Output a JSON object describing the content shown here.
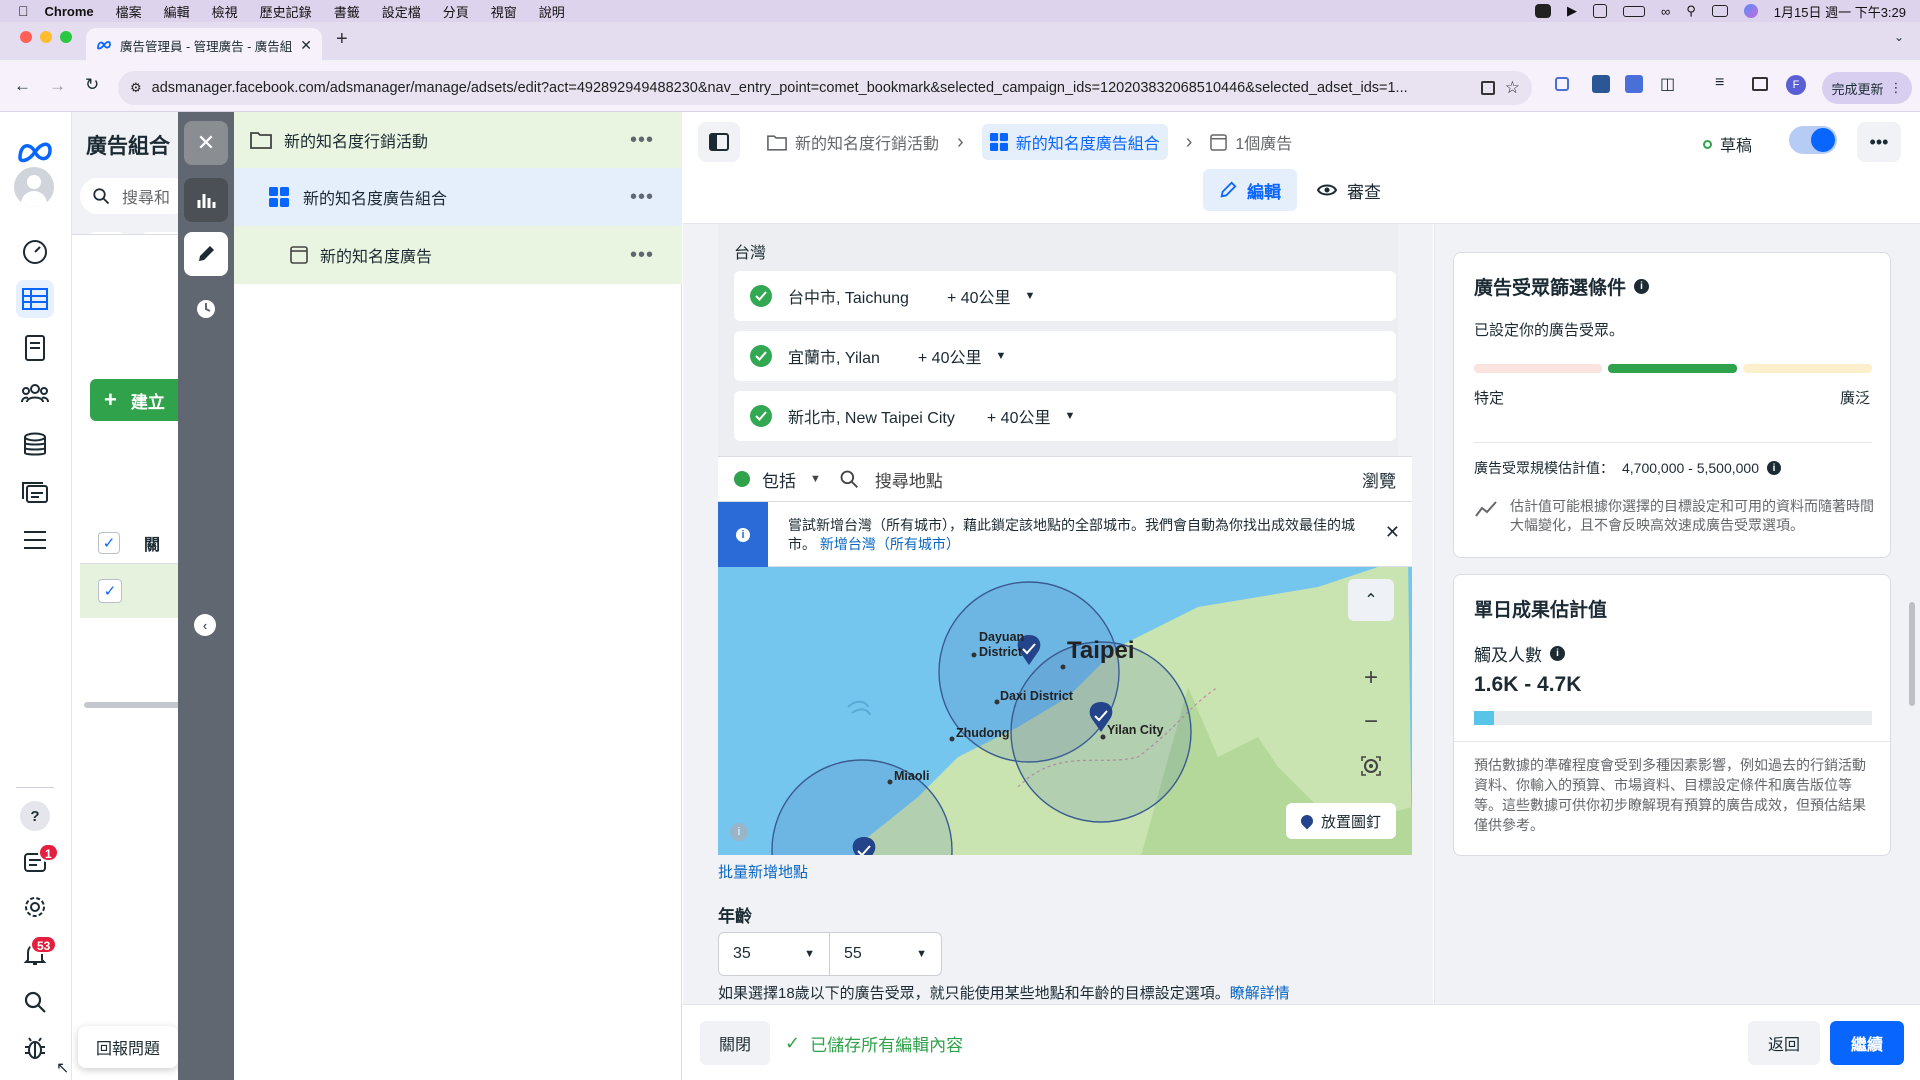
{
  "menubar": {
    "app": "Chrome",
    "items": [
      "檔案",
      "編輯",
      "檢視",
      "歷史記錄",
      "書籤",
      "設定檔",
      "分頁",
      "視窗",
      "說明"
    ],
    "clock": "1月15日 週一 下午3:29"
  },
  "browser": {
    "tab_title": "廣告管理員 - 管理廣告 - 廣告組",
    "url": "adsmanager.facebook.com/adsmanager/manage/adsets/edit?act=492892949488230&nav_entry_point=comet_bookmark&selected_campaign_ids=120203832068510446&selected_adset_ids=1...",
    "update_label": "完成更新",
    "profile_initial": "F"
  },
  "left_panel": {
    "title": "廣告組合",
    "search_placeholder": "搜尋和",
    "create_label": "建立",
    "column_header": "關",
    "report_problem": "回報問題"
  },
  "nav_badges": {
    "notifications_a": "1",
    "notifications_b": "53"
  },
  "tree": {
    "campaign": "新的知名度行銷活動",
    "adset": "新的知名度廣告組合",
    "ad": "新的知名度廣告"
  },
  "breadcrumb": {
    "campaign": "新的知名度行銷活動",
    "adset": "新的知名度廣告組合",
    "ads": "1個廣告",
    "status": "草稿"
  },
  "mode_tabs": {
    "edit": "編輯",
    "review": "審查"
  },
  "locations": {
    "country": "台灣",
    "items": [
      {
        "name": "台中市, Taichung",
        "radius": "+ 40公里"
      },
      {
        "name": "宜蘭市, Yilan",
        "radius": "+ 40公里"
      },
      {
        "name": "新北市, New Taipei City",
        "radius": "+ 40公里"
      }
    ],
    "include_label": "包括",
    "search_placeholder": "搜尋地點",
    "browse_label": "瀏覽",
    "tip_text": "嘗試新增台灣（所有城市），藉此鎖定該地點的全部城市。我們會自動為你找出成效最佳的城市。",
    "tip_link": "新增台灣（所有城市）",
    "pin_button": "放置圖釘",
    "bulk_add": "批量新增地點",
    "map_labels": {
      "taipei": "Taipei",
      "dayuan": "Dayuan District",
      "daxi": "Daxi District",
      "zhudong": "Zhudong",
      "yilan": "Yilan City",
      "miaoli": "Miaoli"
    }
  },
  "age": {
    "label": "年齡",
    "min": "35",
    "max": "55",
    "note": "如果選擇18歲以下的廣告受眾，就只能使用某些地點和年齡的目標設定選項。",
    "note_link": "瞭解詳情"
  },
  "audience_card": {
    "title": "廣告受眾篩選條件",
    "status": "已設定你的廣告受眾。",
    "specific": "特定",
    "broad": "廣泛",
    "size_label": "廣告受眾規模估計值：",
    "size_value": "4,700,000 - 5,500,000",
    "note": "估計值可能根據你選擇的目標設定和可用的資料而隨著時間大幅變化，且不會反映高效速成廣告受眾選項。"
  },
  "results_card": {
    "title": "單日成果估計值",
    "reach_label": "觸及人數",
    "reach_value": "1.6K - 4.7K",
    "reach_fill": 0.05,
    "note": "預估數據的準確程度會受到多種因素影響，例如過去的行銷活動資料、你輸入的預算、市場資料、目標設定條件和廣告版位等等。這些數據可供你初步瞭解現有預算的廣告成效，但預估結果僅供參考。"
  },
  "bottom": {
    "close_label": "關閉",
    "saved_text": "已儲存所有編輯內容",
    "back_label": "返回",
    "continue_label": "繼續"
  },
  "colors": {
    "accent": "#0866ff",
    "success": "#31a24c",
    "menubar": "#ded3ec"
  }
}
